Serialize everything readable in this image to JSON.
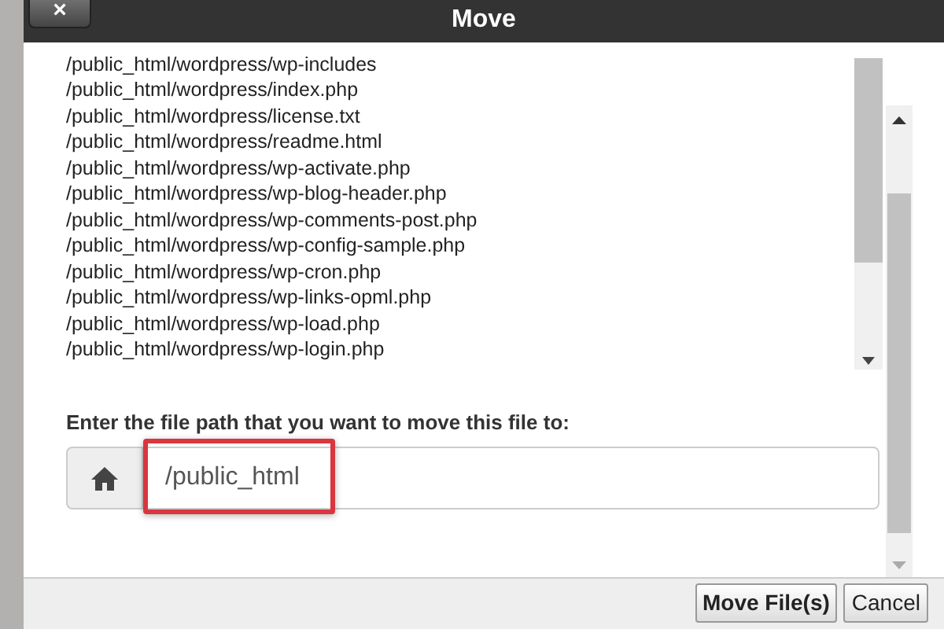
{
  "dialog": {
    "title": "Move",
    "close_button": "×"
  },
  "file_list": [
    "/public_html/wordpress/wp-includes",
    "/public_html/wordpress/index.php",
    "/public_html/wordpress/license.txt",
    "/public_html/wordpress/readme.html",
    "/public_html/wordpress/wp-activate.php",
    "/public_html/wordpress/wp-blog-header.php",
    "/public_html/wordpress/wp-comments-post.php",
    "/public_html/wordpress/wp-config-sample.php",
    "/public_html/wordpress/wp-cron.php",
    "/public_html/wordpress/wp-links-opml.php",
    "/public_html/wordpress/wp-load.php",
    "/public_html/wordpress/wp-login.php"
  ],
  "destination": {
    "label": "Enter the file path that you want to move this file to:",
    "value": "/public_html",
    "highlighted": true
  },
  "buttons": [
    {
      "label": "Move File(s)",
      "kind": "primary"
    },
    {
      "label": "Cancel",
      "kind": "secondary"
    }
  ]
}
